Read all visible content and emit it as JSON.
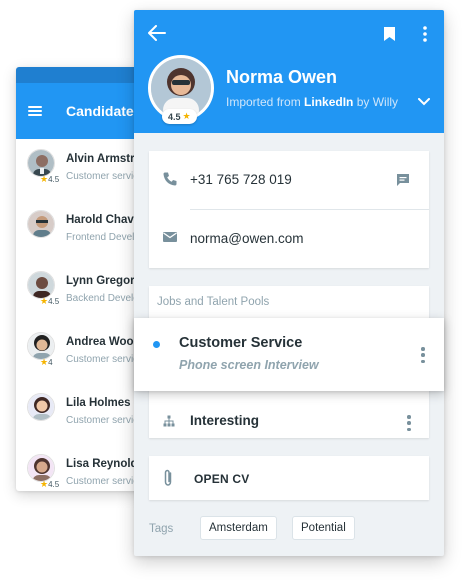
{
  "candidates_list": {
    "title": "Candidates",
    "items": [
      {
        "name": "Alvin Armstrong",
        "subtitle": "Customer service",
        "rating": "4.5"
      },
      {
        "name": "Harold Chavez",
        "subtitle": "Frontend Developer",
        "rating": ""
      },
      {
        "name": "Lynn Gregory",
        "subtitle": "Backend Developer",
        "rating": "4.5"
      },
      {
        "name": "Andrea Woods",
        "subtitle": "Customer service",
        "rating": "4"
      },
      {
        "name": "Lila Holmes",
        "subtitle": "Customer service",
        "rating": ""
      },
      {
        "name": "Lisa Reynolds",
        "subtitle": "Customer service",
        "rating": "4.5"
      }
    ]
  },
  "profile": {
    "name": "Norma Owen",
    "rating": "4.5",
    "source_prefix": "Imported from ",
    "source_name": "LinkedIn",
    "source_suffix": " by Willy",
    "phone": "+31 765 728 019",
    "email": "norma@owen.com",
    "jobs_section_label": "Jobs and Talent Pools",
    "job": {
      "title": "Customer Service",
      "stage": "Phone screen Interview"
    },
    "pool": {
      "name": "Interesting"
    },
    "cv_label": "OPEN CV",
    "tags_label": "Tags",
    "tags": [
      "Amsterdam",
      "Potential"
    ]
  },
  "colors": {
    "primary": "#2196f3",
    "primary_dark": "#1f7fd0",
    "star": "#f5b400",
    "muted_text": "#90a4ae"
  },
  "icons": {
    "back": "arrow-left-icon",
    "bookmark": "bookmark-icon",
    "more": "more-vertical-icon",
    "source_toggle": "chevron-down-icon",
    "phone": "phone-icon",
    "message": "message-icon",
    "email": "email-icon",
    "job_status": "status-dot-icon",
    "pool": "hierarchy-icon",
    "cv": "paperclip-icon",
    "menu": "menu-icon"
  }
}
